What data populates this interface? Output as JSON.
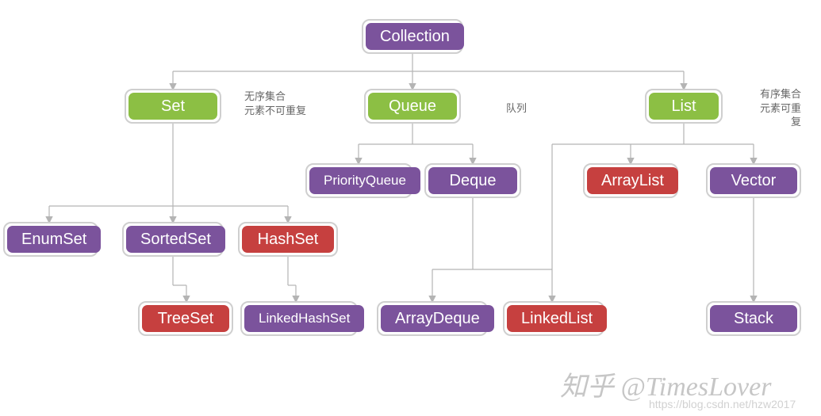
{
  "nodes": {
    "collection": {
      "label": "Collection"
    },
    "set": {
      "label": "Set"
    },
    "queue": {
      "label": "Queue"
    },
    "list": {
      "label": "List"
    },
    "priorityqueue": {
      "label": "PriorityQueue"
    },
    "deque": {
      "label": "Deque"
    },
    "arraylist": {
      "label": "ArrayList"
    },
    "vector": {
      "label": "Vector"
    },
    "enumset": {
      "label": "EnumSet"
    },
    "sortedset": {
      "label": "SortedSet"
    },
    "hashset": {
      "label": "HashSet"
    },
    "treeset": {
      "label": "TreeSet"
    },
    "linkedhashset": {
      "label": "LinkedHashSet"
    },
    "arraydeque": {
      "label": "ArrayDeque"
    },
    "linkedlist": {
      "label": "LinkedList"
    },
    "stack": {
      "label": "Stack"
    }
  },
  "annotations": {
    "set_note": "无序集合\n元素不可重复",
    "queue_note": "队列",
    "list_note": "有序集合\n元素可重\n复"
  },
  "watermark": {
    "main": "知乎 @TimesLover",
    "sub": "https://blog.csdn.net/hzw2017"
  }
}
